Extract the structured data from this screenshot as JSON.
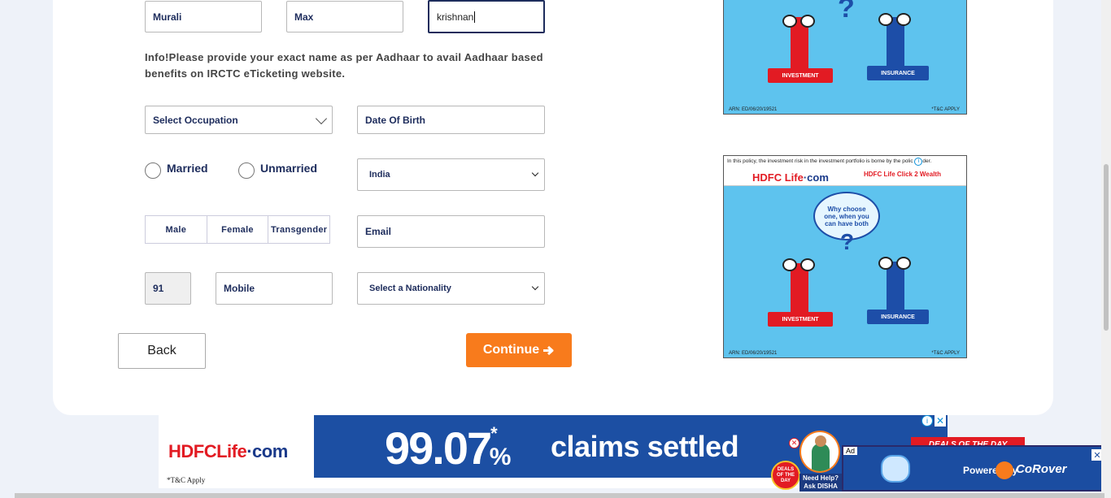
{
  "form": {
    "first_name": "Murali",
    "middle_name": "Max",
    "last_name": "krishnan",
    "info_text": "Info!Please provide your exact name as per Aadhaar to avail Aadhaar based benefits on IRCTC eTicketing website.",
    "occupation_placeholder": "Select Occupation",
    "dob_placeholder": "Date Of Birth",
    "married_label": "Married",
    "unmarried_label": "Unmarried",
    "country": "India",
    "gender_options": [
      "Male",
      "Female",
      "Transgender"
    ],
    "email_placeholder": "Email",
    "country_code": "91",
    "mobile_placeholder": "Mobile",
    "nationality_placeholder": "Select a Nationality",
    "back_label": "Back",
    "continue_label": "Continue"
  },
  "ads": {
    "side_top": {
      "investment_label": "INVESTMENT",
      "insurance_label": "INSURANCE",
      "arn": "ARN: ED/06/20/19521",
      "tc": "*T&C APPLY"
    },
    "side_bottom": {
      "disclaimer": "In this policy, the investment risk in the investment portfolio is borne by the polic",
      "disclaimer_end": "der.",
      "brand": "HDFC Life",
      "brand_suffix": "·com",
      "product": "HDFC Life Click 2 Wealth",
      "bubble_text": "Why choose one, when you can have both",
      "investment_label": "INVESTMENT",
      "insurance_label": "INSURANCE",
      "arn": "ARN: ED/06/20/19521",
      "tc": "*T&C APPLY"
    },
    "banner": {
      "brand": "HDFCLife",
      "brand_suffix": "·com",
      "tc": "*T&C Apply",
      "big_number": "99.07",
      "star": "*",
      "percent": "%",
      "claims": "claims settled",
      "deals": "DEALS OF THE DAY",
      "help_line1": "Need Help?",
      "help_line2": "Ask DISHA",
      "ad_badge": "Ad",
      "powered_by": "Powered by",
      "corover": "CoRover"
    }
  },
  "colors": {
    "primary_text": "#1d2c5c",
    "continue_bg": "#f87b1c",
    "hdfc_red": "#e21b23",
    "hdfc_blue": "#1a3a8a"
  }
}
